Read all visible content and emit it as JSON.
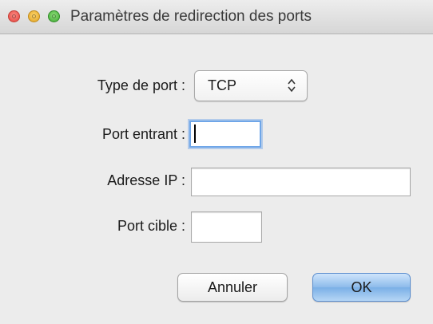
{
  "window": {
    "title": "Paramètres de redirection des ports"
  },
  "form": {
    "port_type_label": "Type de port :",
    "port_type_value": "TCP",
    "incoming_port_label": "Port entrant :",
    "incoming_port_value": "",
    "ip_address_label": "Adresse IP :",
    "ip_address_value": "",
    "target_port_label": "Port cible :",
    "target_port_value": ""
  },
  "buttons": {
    "cancel_label": "Annuler",
    "ok_label": "OK"
  },
  "icons": {
    "window_controls": [
      "close-icon",
      "minimize-icon",
      "zoom-icon"
    ],
    "popup_arrows": "updown-arrows-icon"
  },
  "colors": {
    "focus_ring": "#6fa6e8",
    "default_button": "#8dbbeb"
  }
}
